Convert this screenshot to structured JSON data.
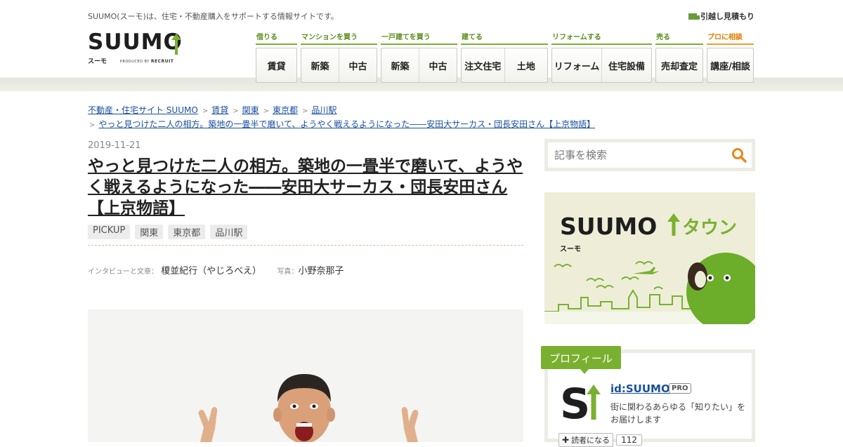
{
  "header": {
    "tagline": "SUUMO(スーモ)は、住宅・不動産購入をサポートする情報サイトです。",
    "moving_estimate_label": "引越し見積もり",
    "logo": {
      "word": "SUUMO",
      "kana": "スーモ",
      "produced_by": "PRODUCED BY",
      "recruit": "RECRUIT"
    }
  },
  "nav": [
    {
      "category": "借りる",
      "items": [
        "賃貸"
      ]
    },
    {
      "category": "マンションを買う",
      "items": [
        "新築",
        "中古"
      ]
    },
    {
      "category": "一戸建てを買う",
      "items": [
        "新築",
        "中古"
      ]
    },
    {
      "category": "建てる",
      "items": [
        "注文住宅",
        "土地"
      ]
    },
    {
      "category": "リフォームする",
      "items": [
        "リフォーム",
        "住宅設備"
      ]
    },
    {
      "category": "売る",
      "items": [
        "売却査定"
      ]
    },
    {
      "category": "プロに相談",
      "items": [
        "講座/相談"
      ]
    }
  ],
  "breadcrumb": {
    "items": [
      "不動産・住宅サイト SUUMO",
      "賃貸",
      "関東",
      "東京都",
      "品川駅"
    ],
    "current": "やっと見つけた二人の相方。築地の一畳半で磨いて、ようやく戦えるようになった――安田大サーカス・団長安田さん【上京物語】"
  },
  "article": {
    "date": "2019-11-21",
    "title": "やっと見つけた二人の相方。築地の一畳半で磨いて、ようやく戦えるようになった――安田大サーカス・団長安田さん【上京物語】",
    "tags": [
      "PICKUP",
      "関東",
      "東京都",
      "品川駅"
    ],
    "interview_label": "インタビューと文章：",
    "interview_name": "榎並紀行（やじろべえ）",
    "photo_label": "写真：",
    "photo_name": "小野奈那子"
  },
  "sidebar": {
    "search_placeholder": "記事を検索",
    "town_banner": {
      "word": "SUUMO",
      "town": "タウン",
      "kana": "スーモ"
    },
    "profile": {
      "heading": "プロフィール",
      "name": "id:SUUMO",
      "badge": "PRO",
      "description": "街に関わるあらゆる「知りたい」をお届けします",
      "subscribe_label": "読者になる",
      "subscriber_count": "112"
    }
  },
  "colors": {
    "accent_green": "#7ab030",
    "nav_green": "#5a8e1b",
    "pro_orange": "#e37b00",
    "link_blue": "#1a4fa0"
  }
}
